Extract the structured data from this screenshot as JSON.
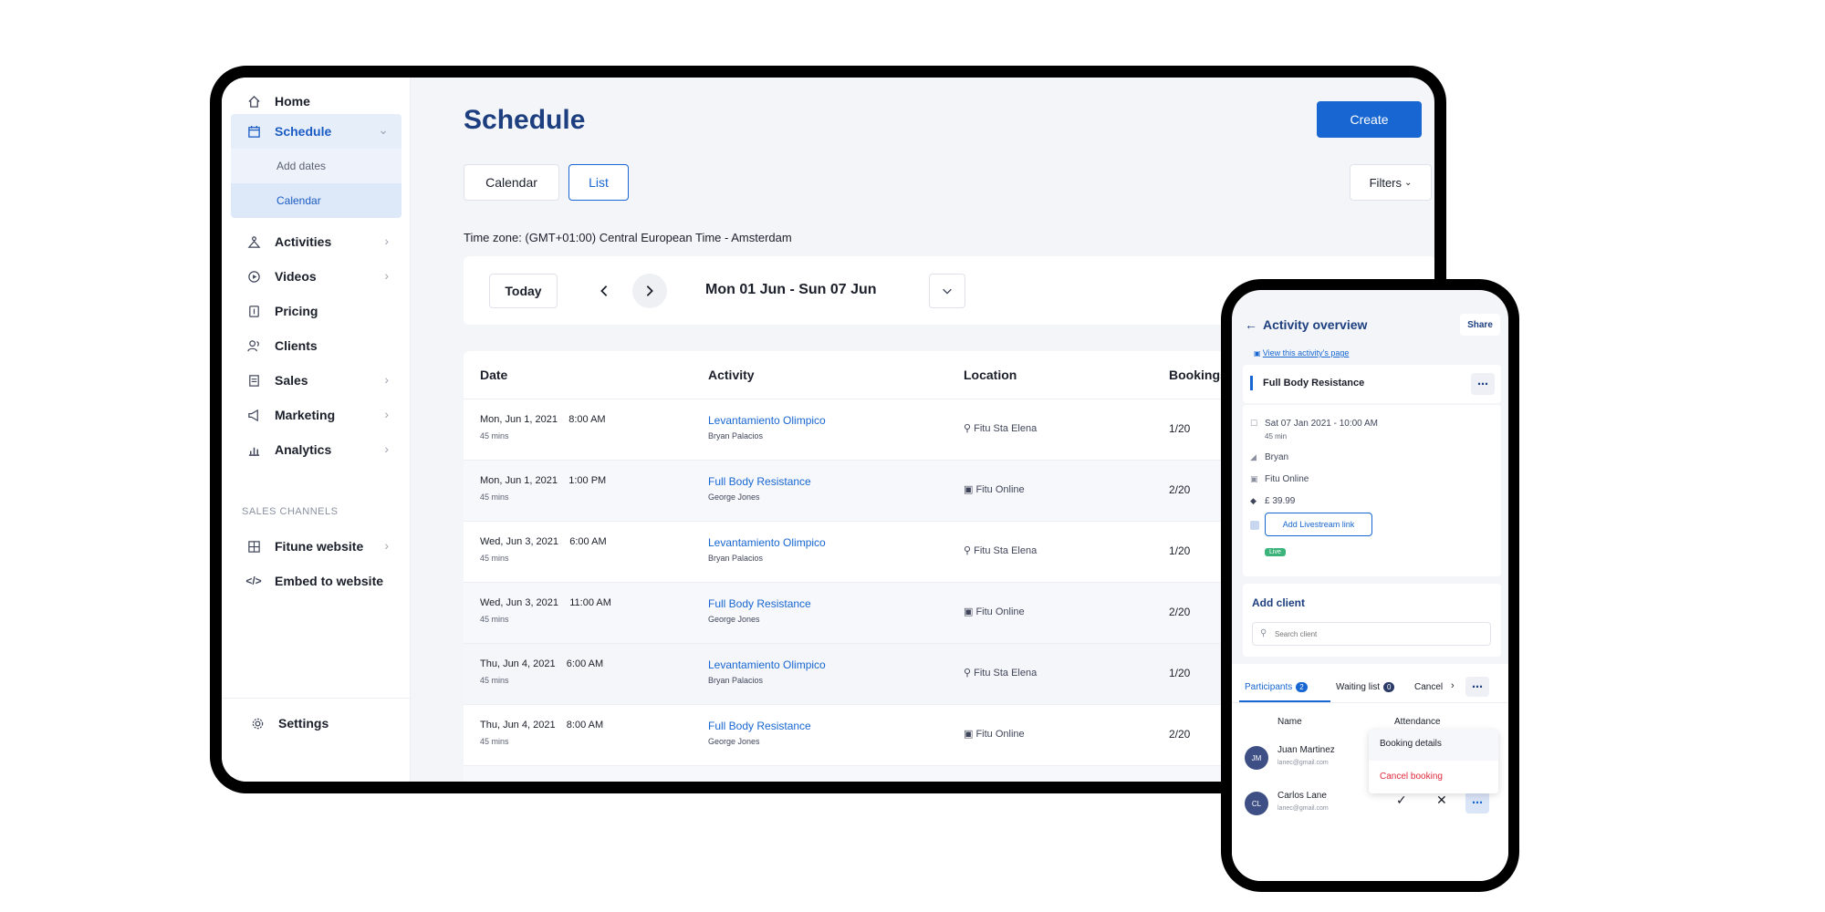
{
  "sidebar": {
    "items": [
      {
        "label": "Home"
      },
      {
        "label": "Schedule"
      },
      {
        "label": "Activities"
      },
      {
        "label": "Videos"
      },
      {
        "label": "Pricing"
      },
      {
        "label": "Clients"
      },
      {
        "label": "Sales"
      },
      {
        "label": "Marketing"
      },
      {
        "label": "Analytics"
      }
    ],
    "schedule_sub": [
      {
        "label": "Add dates"
      },
      {
        "label": "Calendar"
      }
    ],
    "section_label": "SALES CHANNELS",
    "channels": [
      {
        "label": "Fitune website"
      },
      {
        "label": "Embed to website"
      }
    ],
    "settings_label": "Settings"
  },
  "main": {
    "title": "Schedule",
    "create_label": "Create",
    "view_tabs": [
      "Calendar",
      "List"
    ],
    "filters_label": "Filters",
    "timezone": "Time zone: (GMT+01:00) Central European Time - Amsterdam",
    "today_label": "Today",
    "date_range": "Mon 01 Jun - Sun 07 Jun",
    "table": {
      "headers": [
        "Date",
        "Activity",
        "Location",
        "Bookings"
      ],
      "rows": [
        {
          "date": "Mon, Jun 1, 2021    8:00 AM",
          "duration": "45 mins",
          "activity": "Levantamiento Olimpico",
          "instructor": "Bryan Palacios",
          "location": "Fitu Sta Elena",
          "bookings": "1/20"
        },
        {
          "date": "Mon, Jun 1, 2021    1:00 PM",
          "duration": "45 mins",
          "activity": "Full Body Resistance",
          "instructor": "George Jones",
          "location": "Fitu Online",
          "bookings": "2/20"
        },
        {
          "date": "Wed, Jun 3, 2021    6:00 AM",
          "duration": "45 mins",
          "activity": "Levantamiento Olimpico",
          "instructor": "Bryan Palacios",
          "location": "Fitu Sta Elena",
          "bookings": "1/20"
        },
        {
          "date": "Wed, Jun 3, 2021    11:00 AM",
          "duration": "45 mins",
          "activity": "Full Body Resistance",
          "instructor": "George Jones",
          "location": "Fitu Online",
          "bookings": "2/20"
        },
        {
          "date": "Thu, Jun 4, 2021    6:00 AM",
          "duration": "45 mins",
          "activity": "Levantamiento Olimpico",
          "instructor": "Bryan Palacios",
          "location": "Fitu Sta Elena",
          "bookings": "1/20"
        },
        {
          "date": "Thu, Jun 4, 2021    8:00 AM",
          "duration": "45 mins",
          "activity": "Full Body Resistance",
          "instructor": "George Jones",
          "location": "Fitu Online",
          "bookings": "2/20"
        }
      ]
    }
  },
  "phone": {
    "title": "Activity overview",
    "share_label": "Share",
    "view_page_link": "View this activity's page",
    "activity_name": "Full Body Resistance",
    "datetime": "Sat 07 Jan 2021 - 10:00 AM",
    "duration": "45 min",
    "instructor": "Bryan",
    "location": "Fitu Online",
    "price": "£ 39.99",
    "livestream_label": "Add Livestream link",
    "live_badge": "Live",
    "add_client_title": "Add client",
    "search_placeholder": "Search client",
    "tabs": [
      {
        "label": "Participants",
        "count": "2"
      },
      {
        "label": "Waiting list",
        "count": "0"
      },
      {
        "label": "Cancel"
      }
    ],
    "col_name": "Name",
    "col_attendance": "Attendance",
    "participants": [
      {
        "initials": "JM",
        "name": "Juan Martinez",
        "email": "lanec@gmail.com"
      },
      {
        "initials": "CL",
        "name": "Carlos Lane",
        "email": "lanec@gmail.com"
      }
    ],
    "menu": {
      "booking_details": "Booking details",
      "cancel_booking": "Cancel booking"
    },
    "colors": {
      "accent": "#1766d1",
      "danger": "#e0283a",
      "live": "#3bb37a"
    }
  }
}
